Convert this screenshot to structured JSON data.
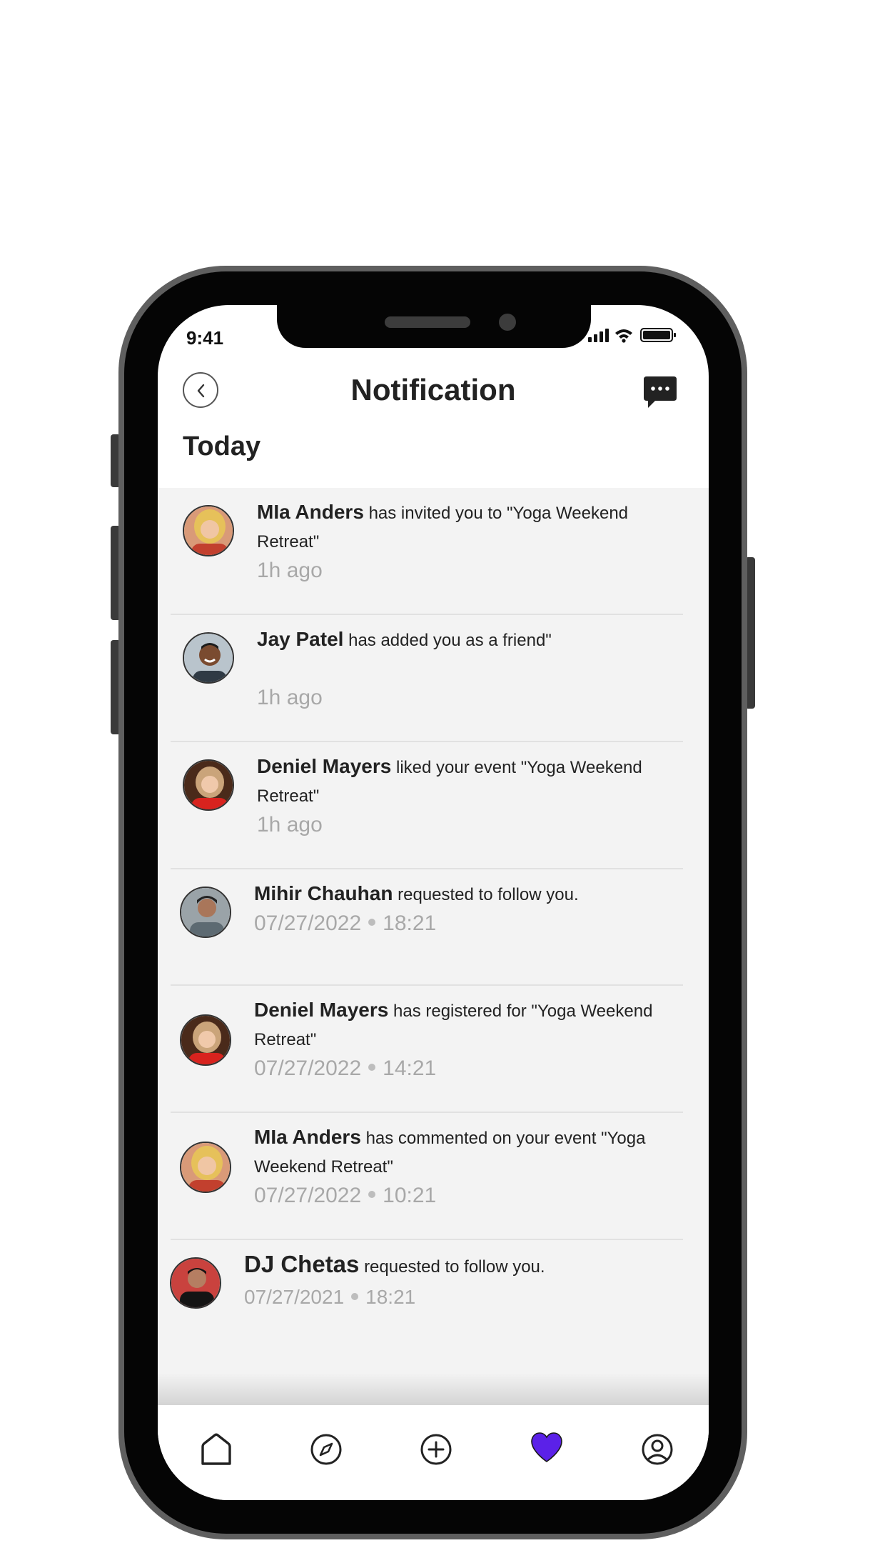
{
  "status_bar": {
    "time": "9:41"
  },
  "header": {
    "title": "Notification"
  },
  "section": {
    "title": "Today"
  },
  "notifications": [
    {
      "name": "MIa Anders",
      "text": "has invited you to \"Yoga Weekend Retreat\"",
      "time": "1h ago",
      "avatar": "woman-blonde"
    },
    {
      "name": "Jay Patel",
      "text": "has added you as a friend\"",
      "time": "1h ago",
      "avatar": "man-smiling"
    },
    {
      "name": "Deniel Mayers",
      "text": "liked your event \"Yoga Weekend Retreat\"",
      "time": "1h ago",
      "avatar": "woman-red"
    },
    {
      "name": "Mihir Chauhan",
      "text": "requested to follow you.",
      "date": "07/27/2022",
      "clock": "18:21",
      "avatar": "man-cap"
    },
    {
      "name": "Deniel Mayers",
      "text": "has registered for \"Yoga Weekend Retreat\"",
      "date": "07/27/2022",
      "clock": "14:21",
      "avatar": "woman-red"
    },
    {
      "name": "MIa Anders",
      "text": "has commented on your event \"Yoga Weekend Retreat\"",
      "date": "07/27/2022",
      "clock": "10:21",
      "avatar": "woman-blonde"
    },
    {
      "name": "DJ Chetas",
      "text": "requested to follow you.",
      "date": "07/27/2021",
      "clock": "18:21",
      "avatar": "dj"
    }
  ],
  "nav": {
    "items": [
      "home-icon",
      "explore-icon",
      "add-icon",
      "heart-icon",
      "profile-icon"
    ],
    "active": "heart-icon",
    "accent": "#5b21e8"
  }
}
